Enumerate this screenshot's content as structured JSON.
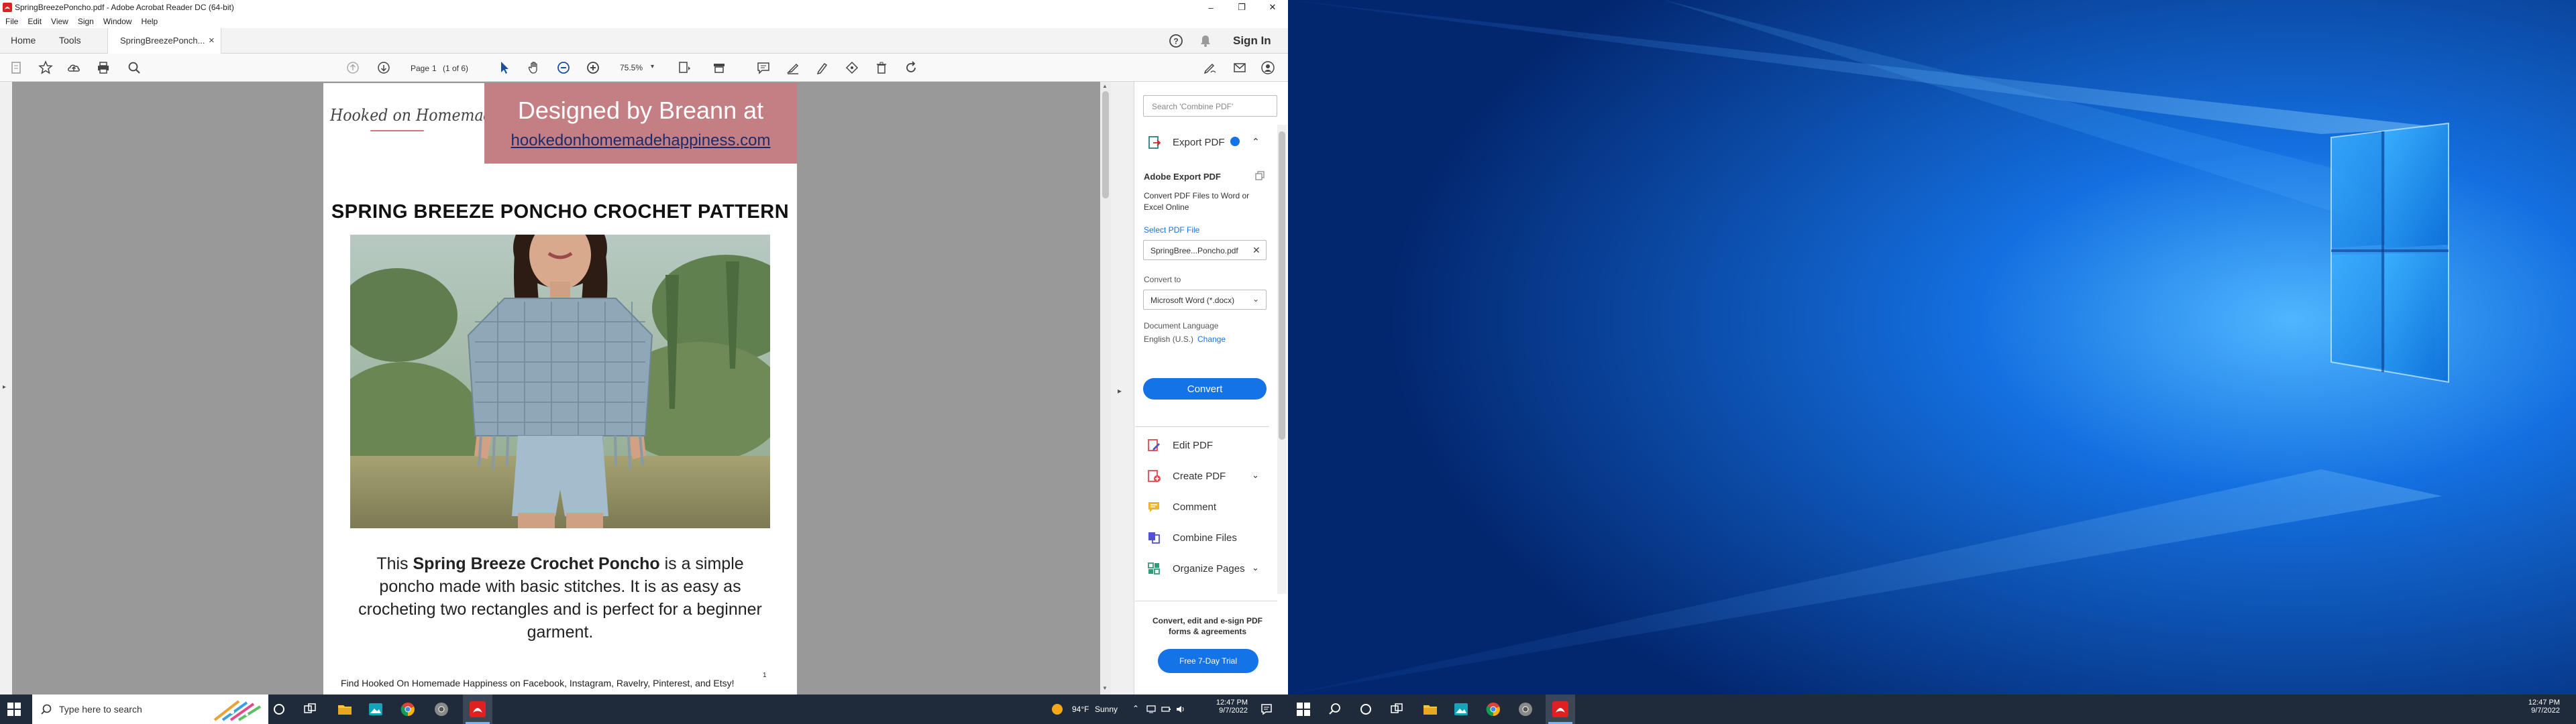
{
  "window": {
    "title": "SpringBreezePoncho.pdf - Adobe Acrobat Reader DC (64-bit)",
    "minimize": "–",
    "maximize": "❐",
    "close": "✕"
  },
  "menu": [
    "File",
    "Edit",
    "View",
    "Sign",
    "Window",
    "Help"
  ],
  "tabs": {
    "home": "Home",
    "tools": "Tools",
    "document": "SpringBreezePonch...",
    "close": "×",
    "sign_in": "Sign In"
  },
  "toolbar": {
    "page_label": "Page",
    "page_value": "1",
    "page_of": "(1 of 6)",
    "zoom": "75.5%"
  },
  "pdf": {
    "logo": "Hooked on Homemade Happiness",
    "banner_line1": "Designed by Breann at",
    "banner_link": "hookedonhomemadehappiness.com",
    "title": "SPRING BREEZE PONCHO CROCHET PATTERN",
    "desc_pre": "This ",
    "desc_bold": "Spring Breeze Crochet Poncho",
    "desc_post": " is a simple poncho made with basic stitches. It is as easy as crocheting two rectangles and is perfect for a beginner garment.",
    "footer": "Find Hooked On Homemade Happiness  on Facebook, Instagram, Ravelry, Pinterest, and Etsy!",
    "page_number": "1"
  },
  "pane": {
    "search_placeholder": "Search 'Combine PDF'",
    "export_header": "Export PDF",
    "export_title": "Adobe Export PDF",
    "export_desc": "Convert PDF Files to Word or Excel Online",
    "select_pdf": "Select PDF File",
    "file_name": "SpringBree...Poncho.pdf",
    "convert_to": "Convert to",
    "format": "Microsoft Word (*.docx)",
    "doc_language": "Document Language",
    "language": "English (U.S.)",
    "change": "Change",
    "convert_btn": "Convert",
    "tools": [
      {
        "label": "Edit PDF",
        "color": "#e34850"
      },
      {
        "label": "Create PDF",
        "color": "#e34850"
      },
      {
        "label": "Comment",
        "color": "#f0b429"
      },
      {
        "label": "Combine Files",
        "color": "#5151d3"
      },
      {
        "label": "Organize Pages",
        "color": "#2d9d78"
      }
    ],
    "promo": "Convert, edit and e-sign PDF forms & agreements",
    "trial_btn": "Free 7-Day Trial"
  },
  "taskbar": {
    "search_placeholder": "Type here to search",
    "weather_temp": "94°F",
    "weather_cond": "Sunny",
    "time": "12:47 PM",
    "date": "9/7/2022"
  },
  "colors": {
    "acrobat_red": "#e02020",
    "accent_blue": "#1473e6",
    "banner_pink": "#c47f85",
    "taskbar": "#1f2b3a",
    "desktop_blue": "#0a52c4"
  }
}
